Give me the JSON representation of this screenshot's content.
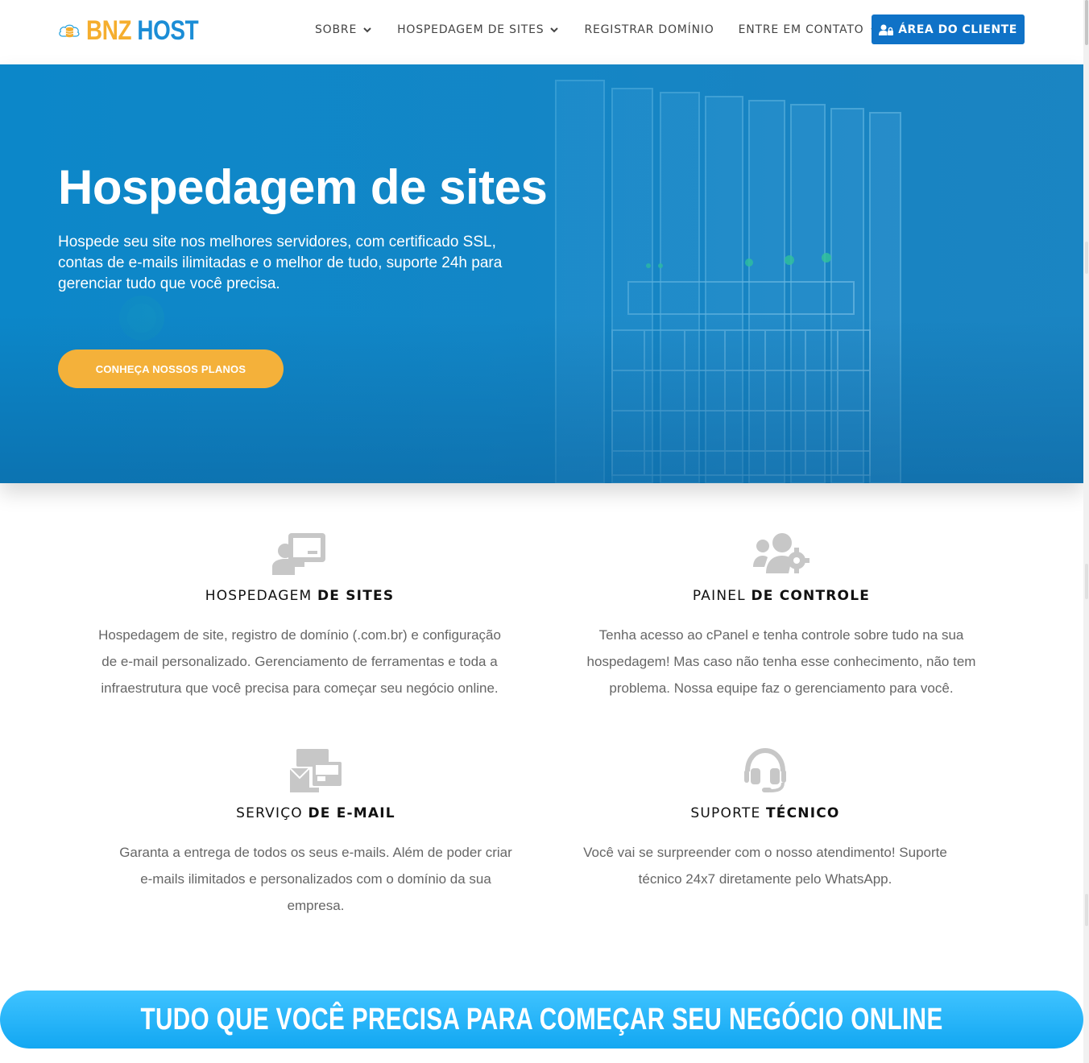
{
  "brand": {
    "name_part1": "BNZ",
    "name_part2": "HOST",
    "colors": {
      "orange": "#f5ae2e",
      "blue": "#1b8dd6"
    }
  },
  "nav": {
    "items": [
      {
        "label": "SOBRE",
        "dropdown": true
      },
      {
        "label": "HOSPEDAGEM DE SITES",
        "dropdown": true
      },
      {
        "label": "REGISTRAR DOMÍNIO",
        "dropdown": false
      },
      {
        "label": "ENTRE EM CONTATO",
        "dropdown": true
      }
    ],
    "client_button": "ÁREA DO CLIENTE"
  },
  "hero": {
    "title": "Hospedagem de sites",
    "subtitle": "Hospede seu site nos melhores servidores, com certificado SSL, contas de e-mails ilimitadas e o melhor de tudo, suporte 24h para gerenciar tudo que você precisa.",
    "cta": "CONHEÇA NOSSOS PLANOS",
    "cta_color": "#f4b13a"
  },
  "features": [
    {
      "icon": "presentation-icon",
      "title_light": "HOSPEDAGEM ",
      "title_bold": "DE SITES",
      "description": "Hospedagem de site, registro de domínio (.com.br) e configuração de e-mail personalizado. Gerenciamento de ferramentas e toda a infraestrutura que você precisa para começar seu negócio online."
    },
    {
      "icon": "users-cog-icon",
      "title_light": "PAINEL ",
      "title_bold": "DE CONTROLE",
      "description": "Tenha acesso ao cPanel e tenha controle sobre tudo na sua hospedagem! Mas caso não tenha esse conhecimento, não tem problema. Nossa equipe faz o gerenciamento para você."
    },
    {
      "icon": "mail-bulk-icon",
      "title_light": "SERVIÇO ",
      "title_bold": "DE E-MAIL",
      "description": "Garanta a entrega de todos os seus e-mails. Além de poder criar e-mails ilimitados e personalizados com o domínio da sua empresa."
    },
    {
      "icon": "headset-icon",
      "title_light": "SUPORTE ",
      "title_bold": "TÉCNICO",
      "description": "Você vai se surpreender com o nosso atendimento! Suporte técnico 24x7 diretamente pelo WhatsApp."
    }
  ],
  "banner": {
    "text": "TUDO QUE VOCÊ PRECISA PARA COMEÇAR SEU NEGÓCIO ONLINE"
  }
}
